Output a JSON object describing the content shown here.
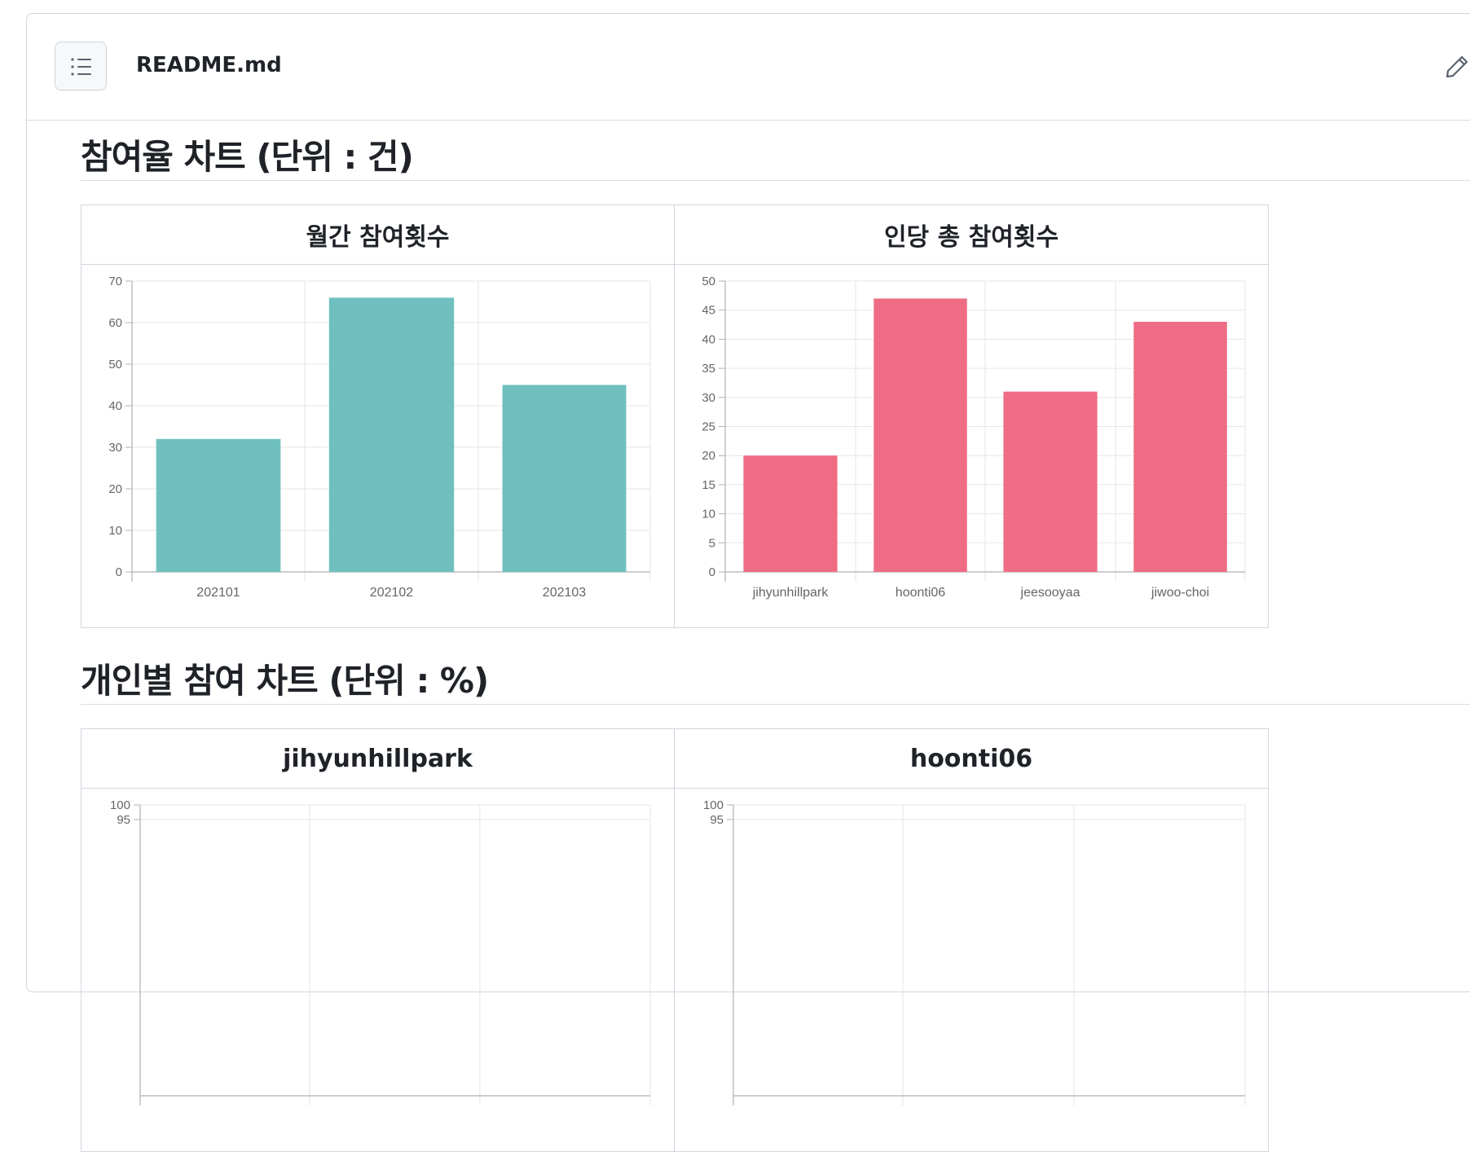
{
  "file": {
    "name": "README.md",
    "toc_icon": "list-unordered-icon",
    "edit_icon": "pencil-icon"
  },
  "sections": [
    {
      "heading": "참여율 차트 (단위 : 건)"
    },
    {
      "heading": "개인별 참여 차트 (단위 : %)"
    }
  ],
  "tables": {
    "top": {
      "headers": [
        "월간 참여횟수",
        "인당 총 참여횟수"
      ]
    },
    "bottom": {
      "headers": [
        "jihyunhillpark",
        "hoonti06"
      ]
    }
  },
  "colors": {
    "teal": "#6fbfbf",
    "pink": "#ef6d84",
    "grid": "#e6e6e6",
    "axis": "#b0b0b0",
    "tick_text": "#666666"
  },
  "chart_data": [
    {
      "type": "bar",
      "title": "월간 참여횟수",
      "categories": [
        "202101",
        "202102",
        "202103"
      ],
      "values": [
        32,
        66,
        45
      ],
      "ylim": [
        0,
        70
      ],
      "yticks": [
        0,
        10,
        20,
        30,
        40,
        50,
        60,
        70
      ],
      "grid": true
    },
    {
      "type": "bar",
      "title": "인당 총 참여횟수",
      "categories": [
        "jihyunhillpark",
        "hoonti06",
        "jeesooyaa",
        "jiwoo-choi"
      ],
      "values": [
        20,
        47,
        31,
        43
      ],
      "ylim": [
        0,
        50
      ],
      "yticks": [
        0,
        5,
        10,
        15,
        20,
        25,
        30,
        35,
        40,
        45,
        50
      ],
      "grid": true
    },
    {
      "type": "bar",
      "title": "jihyunhillpark",
      "categories": [],
      "values": [],
      "ylim": [
        0,
        100
      ],
      "yticks": [
        95,
        100
      ],
      "grid": true
    },
    {
      "type": "bar",
      "title": "hoonti06",
      "categories": [],
      "values": [],
      "ylim": [
        0,
        100
      ],
      "yticks": [
        95,
        100
      ],
      "grid": true
    }
  ]
}
